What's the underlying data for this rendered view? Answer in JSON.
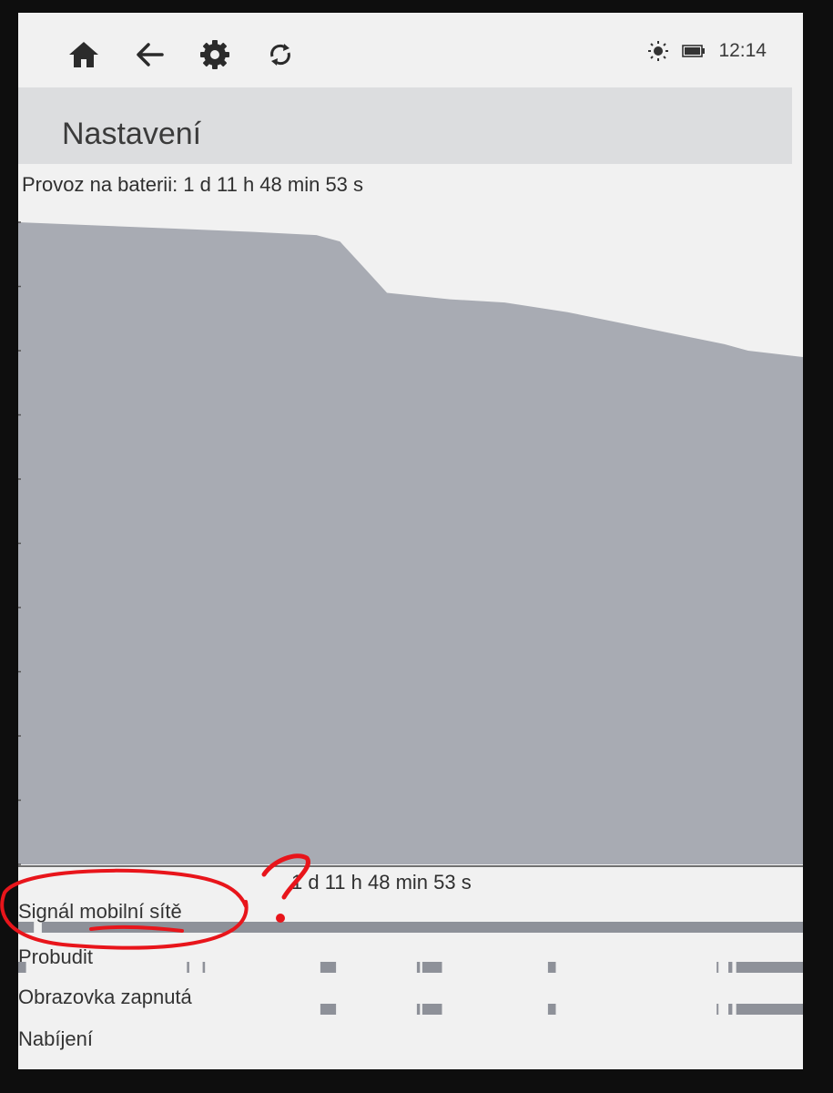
{
  "status_bar": {
    "time": "12:14",
    "icons": [
      "brightness-icon",
      "battery-icon"
    ]
  },
  "toolbar": {
    "icons": [
      "home-icon",
      "back-arrow-icon",
      "gear-icon",
      "sync-icon"
    ]
  },
  "header": {
    "title": "Nastavení"
  },
  "battery": {
    "usage_label": "Provoz na baterii: 1 d 11 h 48 min 53 s",
    "duration_label": "1 d 11 h 48 min 53 s"
  },
  "chart_data": {
    "type": "area",
    "title": "Provoz na baterii: 1 d 11 h 48 min 53 s",
    "xlabel": "1 d 11 h 48 min 53 s",
    "ylabel": "",
    "xlim": [
      0,
      1
    ],
    "ylim": [
      0,
      100
    ],
    "x": [
      0.0,
      0.1,
      0.2,
      0.3,
      0.38,
      0.41,
      0.44,
      0.47,
      0.55,
      0.62,
      0.7,
      0.78,
      0.86,
      0.9,
      0.93,
      1.0
    ],
    "y": [
      100,
      99.5,
      99,
      98.5,
      98,
      97,
      93,
      89,
      88,
      87.5,
      86,
      84,
      82,
      81,
      80,
      79
    ],
    "fill_color": "#a8abb3",
    "grid": false
  },
  "timelines": [
    {
      "label": "Signál mobilní sítě",
      "segments": [
        [
          0.0,
          0.02
        ],
        [
          0.03,
          1.0
        ]
      ]
    },
    {
      "label": "Probudit",
      "segments": [
        [
          0.0,
          0.01
        ],
        [
          0.215,
          0.218
        ],
        [
          0.235,
          0.238
        ],
        [
          0.385,
          0.405
        ],
        [
          0.508,
          0.512
        ],
        [
          0.515,
          0.54
        ],
        [
          0.675,
          0.685
        ],
        [
          0.89,
          0.892
        ],
        [
          0.905,
          0.91
        ],
        [
          0.915,
          1.0
        ]
      ]
    },
    {
      "label": "Obrazovka zapnutá",
      "segments": [
        [
          0.385,
          0.405
        ],
        [
          0.508,
          0.512
        ],
        [
          0.515,
          0.54
        ],
        [
          0.675,
          0.685
        ],
        [
          0.89,
          0.892
        ],
        [
          0.905,
          0.91
        ],
        [
          0.915,
          1.0
        ]
      ]
    },
    {
      "label": "Nabíjení",
      "segments": []
    }
  ],
  "annotation": {
    "color": "#e8151b"
  }
}
